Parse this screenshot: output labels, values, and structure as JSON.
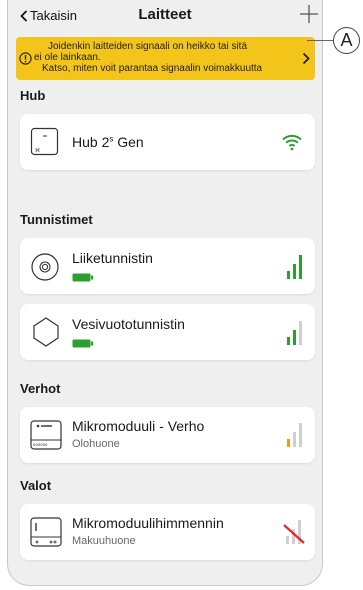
{
  "nav": {
    "back_label": "Takaisin",
    "title": "Laitteet",
    "add_icon": "plus-icon"
  },
  "callout": {
    "label": "A"
  },
  "banner": {
    "line1": "Joidenkin laitteiden signaali on heikko tai sitä",
    "line2": "ei ole lainkaan.",
    "line3": "Katso, miten voit parantaa signaalin voimakkuutta",
    "icon": "warning-circle-icon",
    "color": "#f3c51b"
  },
  "sections": {
    "hub": "Hub",
    "sensors": "Tunnistimet",
    "curtains": "Verhot",
    "lights": "Valot"
  },
  "devices": {
    "hub": {
      "name": "Hub 2",
      "sup": "s",
      "name_suffix": " Gen",
      "signal": "wifi-icon"
    },
    "motion": {
      "name": "Liiketunnistin",
      "battery": "full",
      "signal_bars": 3
    },
    "leak": {
      "name": "Vesivuototunnistin",
      "battery": "full",
      "signal_bars": 2
    },
    "curtain": {
      "name": "Mikromoduuli - Verho",
      "room": "Olohuone",
      "signal_bars": 1
    },
    "dimmer": {
      "name": "Mikromoduulihimmennin",
      "room": "Makuuhuone",
      "signal_bars": 0
    }
  },
  "colors": {
    "green": "#2e9e2e",
    "orange": "#f29b1d",
    "red": "#e02828",
    "grey_bar": "#cfcfcf"
  }
}
